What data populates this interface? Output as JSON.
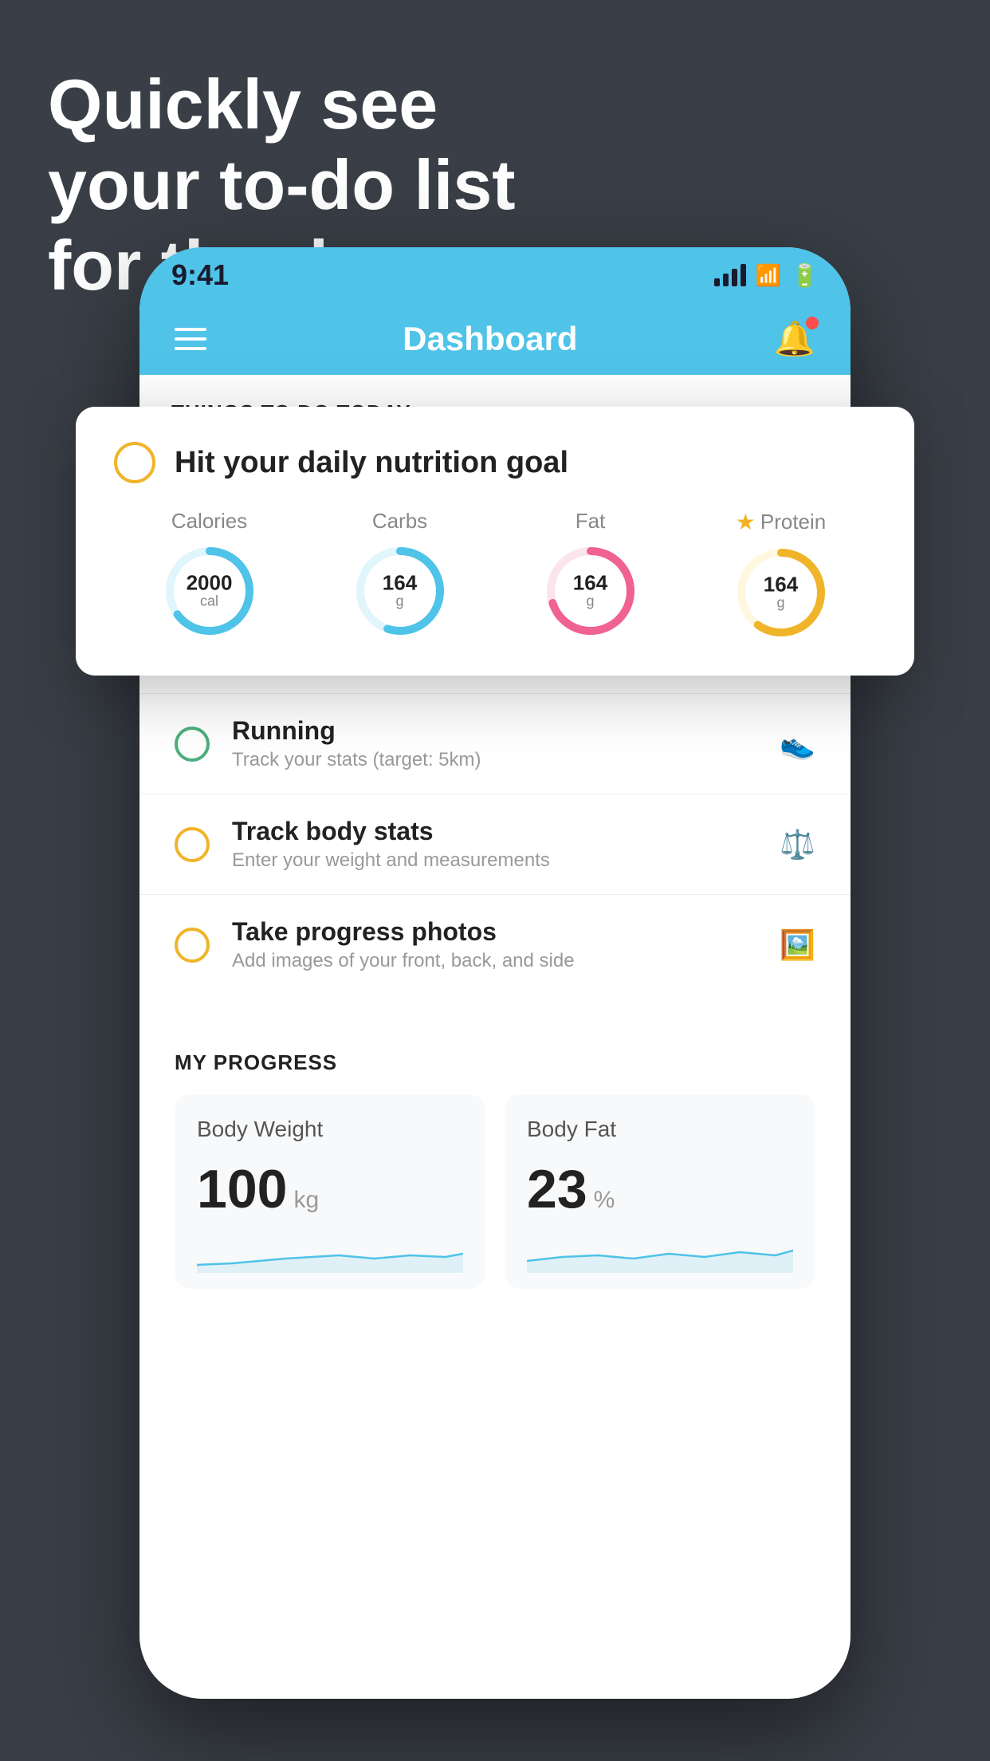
{
  "headline": {
    "line1": "Quickly see",
    "line2": "your to-do list",
    "line3": "for the day."
  },
  "status_bar": {
    "time": "9:41",
    "signal_bars": [
      10,
      16,
      22,
      28
    ],
    "wifi": "wifi",
    "battery": "battery"
  },
  "nav": {
    "title": "Dashboard"
  },
  "things_section": {
    "header": "THINGS TO DO TODAY"
  },
  "nutrition_card": {
    "checkbox_label": "unchecked",
    "title": "Hit your daily nutrition goal",
    "items": [
      {
        "label": "Calories",
        "value": "2000",
        "unit": "cal",
        "color": "#4fc3e8",
        "track_color": "#e0f5fc",
        "percent": 65
      },
      {
        "label": "Carbs",
        "value": "164",
        "unit": "g",
        "color": "#4fc3e8",
        "track_color": "#e0f5fc",
        "percent": 55
      },
      {
        "label": "Fat",
        "value": "164",
        "unit": "g",
        "color": "#f06292",
        "track_color": "#fce4ec",
        "percent": 70
      },
      {
        "label": "Protein",
        "value": "164",
        "unit": "g",
        "color": "#f0b429",
        "track_color": "#fff8e1",
        "percent": 60,
        "starred": true
      }
    ]
  },
  "todo_items": [
    {
      "id": "running",
      "circle_type": "green",
      "title": "Running",
      "subtitle": "Track your stats (target: 5km)",
      "icon": "shoe"
    },
    {
      "id": "body-stats",
      "circle_type": "yellow",
      "title": "Track body stats",
      "subtitle": "Enter your weight and measurements",
      "icon": "scale"
    },
    {
      "id": "photos",
      "circle_type": "yellow",
      "title": "Take progress photos",
      "subtitle": "Add images of your front, back, and side",
      "icon": "person"
    }
  ],
  "progress": {
    "header": "MY PROGRESS",
    "cards": [
      {
        "title": "Body Weight",
        "value": "100",
        "unit": "kg",
        "chart_color": "#4fc3e8"
      },
      {
        "title": "Body Fat",
        "value": "23",
        "unit": "%",
        "chart_color": "#4fc3e8"
      }
    ]
  }
}
